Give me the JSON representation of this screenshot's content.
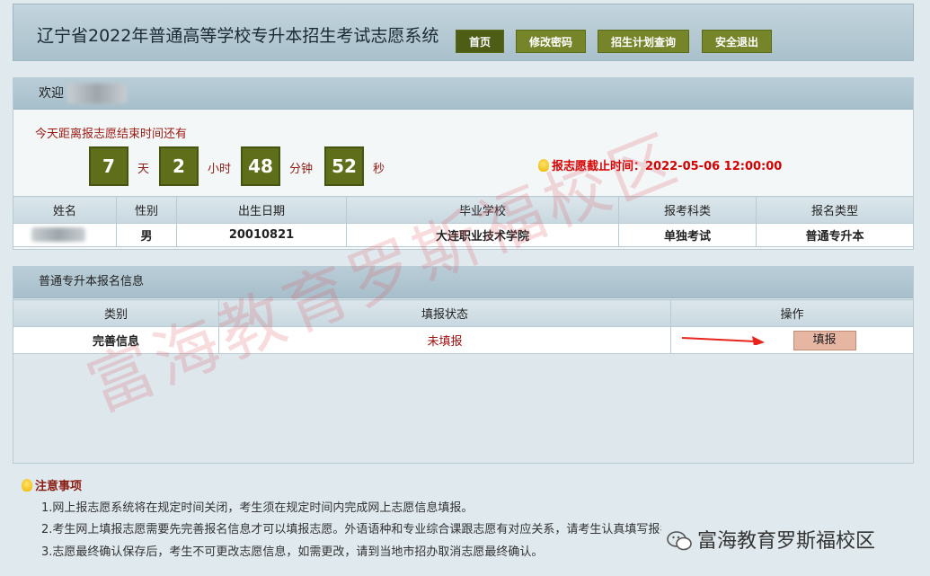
{
  "header": {
    "title": "辽宁省2022年普通高等学校专升本招生考试志愿系统",
    "nav": [
      "首页",
      "修改密码",
      "招生计划查询",
      "安全退出"
    ]
  },
  "welcome": {
    "label": "欢迎",
    "countdown_label": "今天距离报志愿结束时间还有",
    "days": "7",
    "days_unit": "天",
    "hours": "2",
    "hours_unit": "小时",
    "minutes": "48",
    "minutes_unit": "分钟",
    "seconds": "52",
    "seconds_unit": "秒",
    "deadline": "报志愿截止时间：2022-05-06 12:00:00"
  },
  "student_table": {
    "headers": [
      "姓名",
      "性别",
      "出生日期",
      "毕业学校",
      "报考科类",
      "报名类型"
    ],
    "row": {
      "gender": "男",
      "birth": "20010821",
      "school": "大连职业技术学院",
      "category": "单独考试",
      "type": "普通专升本"
    }
  },
  "reg_info": {
    "title": "普通专升本报名信息",
    "headers": [
      "类别",
      "填报状态",
      "操作"
    ],
    "row": {
      "category": "完善信息",
      "status": "未填报",
      "action": "填报"
    }
  },
  "notes": {
    "title": "注意事项",
    "items": [
      "1.网上报志愿系统将在规定时间关闭，考生须在规定时间内完成网上志愿信息填报。",
      "2.考生网上填报志愿需要先完善报名信息才可以填报志愿。外语语种和专业综合课跟志愿有对应关系，请考生认真填写报名信息。",
      "3.志愿最终确认保存后，考生不可更改志愿信息，如需更改，请到当地市招办取消志愿最终确认。"
    ]
  },
  "watermark": "富海教育罗斯福校区",
  "corner_watermark": "富海教育罗斯福校区",
  "colors": {
    "nav_active": "#4e5d15",
    "nav": "#76852a",
    "countdown": "#5e6e1a",
    "deadline": "#d50000",
    "fill_button": "#e6b6a3"
  }
}
